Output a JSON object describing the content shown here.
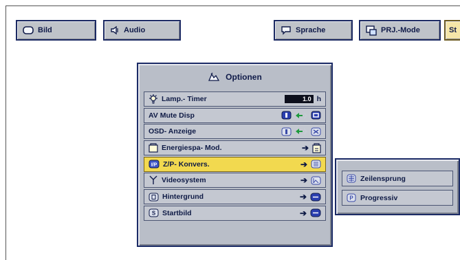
{
  "tabs": [
    {
      "label": "Bild",
      "icon": "monitor-icon"
    },
    {
      "label": "Audio",
      "icon": "speaker-icon"
    },
    {
      "label": "Sprache",
      "icon": "speech-bubble-icon"
    },
    {
      "label": "PRJ.-Mode",
      "icon": "projector-mode-icon"
    },
    {
      "label": "St",
      "icon": ""
    }
  ],
  "panel": {
    "title": "Optionen",
    "title_icon": "options-icon",
    "rows": [
      {
        "label": "Lamp.- Timer",
        "icon": "lamp-icon",
        "value": "1.0",
        "unit": "h"
      },
      {
        "label": "AV Mute Disp",
        "icon": ""
      },
      {
        "label": "OSD- Anzeige",
        "icon": ""
      },
      {
        "label": "Energiespa- Mod.",
        "icon": "energy-icon"
      },
      {
        "label": "Z/P- Konvers.",
        "icon": "ip-conversion-icon"
      },
      {
        "label": "Videosystem",
        "icon": "antenna-icon"
      },
      {
        "label": "Hintergrund",
        "icon": "background-icon"
      },
      {
        "label": "Startbild",
        "icon": "startup-image-icon"
      }
    ]
  },
  "submenu": {
    "items": [
      {
        "label": "Zeilensprung",
        "icon": "interlace-icon"
      },
      {
        "label": "Progressiv",
        "icon": "progressive-icon"
      }
    ]
  },
  "colors": {
    "panel_bg": "#b9bec8",
    "border": "#1b2b66",
    "highlight": "#f2d94f",
    "text": "#0e1a45"
  }
}
